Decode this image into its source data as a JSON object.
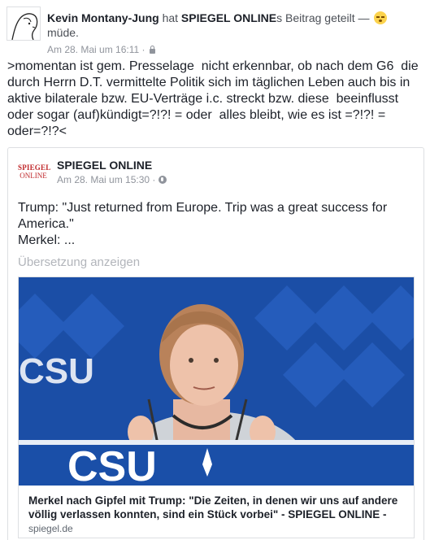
{
  "post": {
    "author": "Kevin Montany-Jung",
    "action_prefix": "hat",
    "shared_page": "SPIEGEL ONLINE",
    "action_suffix": "s Beitrag geteilt —",
    "feeling_icon": "sleepy-emoji-icon",
    "feeling": "müde.",
    "timestamp": "Am 28. Mai um 16:11 ·",
    "privacy_icon": "lock-icon",
    "text": ">momentan ist gem. Presselage  nicht erkennbar, ob nach dem G6  die durch Herrn D.T. vermittelte Politik sich im täglichen Leben auch bis in aktive bilaterale bzw. EU-Verträge i.c. streckt bzw. diese  beeinflusst oder sogar (auf)kündigt=?!?! = oder  alles bleibt, wie es ist =?!?! = oder=?!?<"
  },
  "shared": {
    "logo_line1": "SPIEGEL",
    "logo_line2": "ONLINE",
    "page_name": "SPIEGEL ONLINE",
    "timestamp": "Am 28. Mai um 15:30 ·",
    "privacy_icon": "globe-icon",
    "text_line1": "Trump: \"Just returned from Europe. Trip was a great success for America.\"",
    "text_line2": "Merkel: ...",
    "translate_label": "Übersetzung anzeigen",
    "link": {
      "image_banner_text": "CSU",
      "title": "Merkel nach Gipfel mit Trump: \"Die Zeiten, in denen wir uns auf andere völlig verlassen konnten, sind ein Stück vorbei\" - SPIEGEL ONLINE -",
      "domain": "spiegel.de"
    }
  },
  "colors": {
    "text": "#1d2129",
    "muted": "#90949c",
    "spiegel_red": "#c0282b",
    "csu_blue": "#1a4fa8"
  }
}
